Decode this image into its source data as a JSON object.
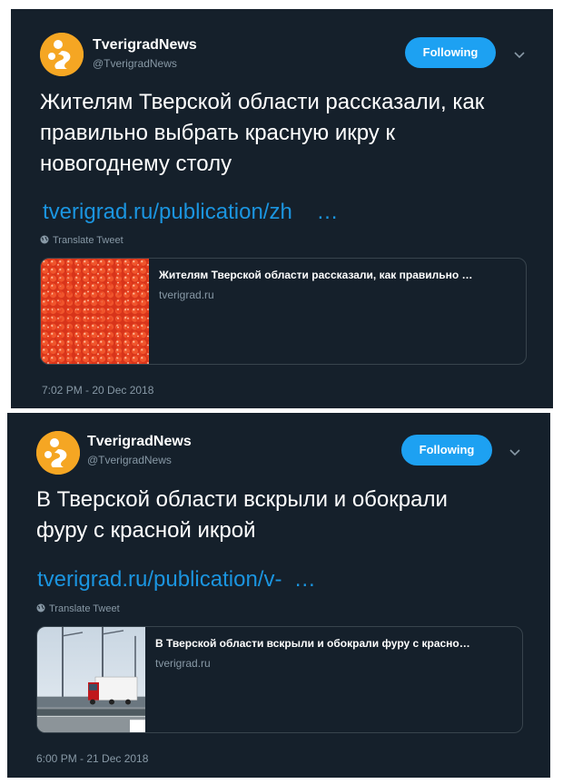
{
  "tweets": [
    {
      "display_name": "TverigradNews",
      "handle": "@TverigradNews",
      "follow_label": "Following",
      "text": "Жителям Тверской области рассказали, как правильно выбрать красную икру к новогоднему столу",
      "link": "tverigrad.ru/publication/zh    …",
      "translate": "Translate Tweet",
      "card": {
        "title": "Жителям Тверской области рассказали, как правильно …",
        "domain": "tverigrad.ru",
        "image": "caviar-photo"
      },
      "timestamp": "7:02 PM - 20 Dec 2018"
    },
    {
      "display_name": "TverigradNews",
      "handle": "@TverigradNews",
      "follow_label": "Following",
      "text": "В Тверской области вскрыли и обокрали фуру с красной икрой",
      "link": "tverigrad.ru/publication/v-  …",
      "translate": "Translate Tweet",
      "card": {
        "title": "В Тверской области вскрыли и обокрали фуру с красно…",
        "domain": "tverigrad.ru",
        "image": "truck-on-bridge-photo"
      },
      "timestamp": "6:00 PM - 21 Dec 2018"
    }
  ],
  "colors": {
    "background": "#15202b",
    "accent": "#1da1f2",
    "link": "#1b95e0",
    "muted": "#8899a6",
    "logo": "#f5a623"
  },
  "icons": [
    "tverigrad-logo-icon",
    "chevron-down-icon",
    "globe-icon"
  ]
}
